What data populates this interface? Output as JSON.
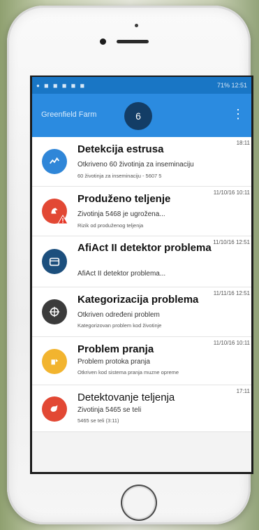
{
  "status_bar": {
    "time": "12:51",
    "signal": "71%"
  },
  "app": {
    "title": "Greenfield Farm",
    "badge_count": "6"
  },
  "notifications": [
    {
      "title": "Detekcija estrusa",
      "time": "18:11",
      "line1": "Otkriveno 60 životinja za inseminaciju",
      "line2": "60 životinja za inseminaciju - 5607 5",
      "icon": "heat-detection-icon",
      "color": "#2f86d8"
    },
    {
      "title": "Produženo teljenje",
      "time": "11/10/16 10:11",
      "line1": "Životinja 5468 je ugrožena...",
      "line2": "Rizik od produženog teljenja",
      "icon": "prolonged-calving-icon",
      "color": "#e24834"
    },
    {
      "title": "AfiAct II detektor problema",
      "time": "11/10/16 12:51",
      "line1": "AfiAct II detektor problema...",
      "line2": "",
      "icon": "calendar-icon",
      "color": "#1c4f7d"
    },
    {
      "title": "Kategorizacija problema",
      "time": "11/11/16 12:51",
      "line1": "Otkriven određeni problem",
      "line2": "Kategorizovan problem kod životinje",
      "icon": "crosshair-icon",
      "color": "#3b3b3b"
    },
    {
      "title": "Problem pranja",
      "time": "11/10/16 10:11",
      "line1": "Problem protoka pranja",
      "line2": "Otkriven kod sistema pranja muzne opreme",
      "icon": "washing-icon",
      "color": "#f2b42f"
    },
    {
      "title": "Detektovanje teljenja",
      "time": "17:11",
      "line1": "Životinja 5465 se teli",
      "line2": "5465 se teli (3:11)",
      "icon": "calving-icon",
      "color": "#e24834"
    }
  ]
}
